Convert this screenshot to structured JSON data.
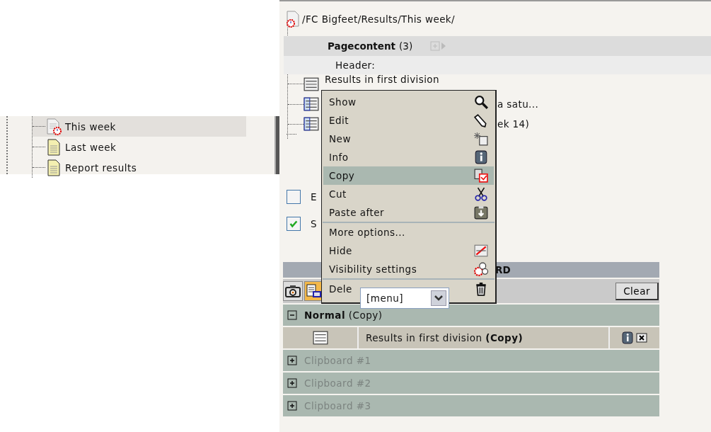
{
  "tree": {
    "items": [
      {
        "label": "This week",
        "kind": "clock-page",
        "selected": true
      },
      {
        "label": "Last week",
        "kind": "page",
        "selected": false
      },
      {
        "label": "Report results",
        "kind": "page",
        "selected": false
      }
    ]
  },
  "path": "/FC Bigfeet/Results/This week/",
  "pagecontent": {
    "title": "Pagecontent",
    "count": "(3)",
    "section": "Header:",
    "rows": [
      {
        "text": "Results in first division",
        "kind": "plain"
      },
      {
        "text": "a satu...",
        "kind": "blue"
      },
      {
        "text": "ek 14)",
        "kind": "blue"
      }
    ]
  },
  "checkboxes": [
    {
      "label": "E",
      "checked": false
    },
    {
      "label": "S",
      "checked": true
    }
  ],
  "clipboard": {
    "header": "RD",
    "select": "[menu]",
    "clear": "Clear",
    "tabs": [
      {
        "kind": "camera",
        "selected": false
      },
      {
        "kind": "doc",
        "selected": true
      }
    ],
    "groups": [
      {
        "title": "**Normal** (Copy)",
        "expanded": true,
        "items": [
          {
            "text": "Results in first division **(Copy)**"
          }
        ]
      },
      {
        "title": "Clipboard #1",
        "expanded": false
      },
      {
        "title": "Clipboard #2",
        "expanded": false
      },
      {
        "title": "Clipboard #3",
        "expanded": false
      }
    ]
  },
  "context_menu": {
    "items": [
      {
        "label": "Show",
        "kind": "search",
        "selected": false,
        "separator_after": false
      },
      {
        "label": "Edit",
        "kind": "pencil",
        "selected": false,
        "separator_after": false
      },
      {
        "label": "New",
        "kind": "new",
        "selected": false,
        "separator_after": false
      },
      {
        "label": "Info",
        "kind": "info",
        "selected": false,
        "separator_after": false
      },
      {
        "label": "Copy",
        "kind": "copy",
        "selected": true,
        "separator_after": false
      },
      {
        "label": "Cut",
        "kind": "cut",
        "selected": false,
        "separator_after": false
      },
      {
        "label": "Paste after",
        "kind": "paste",
        "selected": false,
        "separator_after": true
      },
      {
        "label": "More options...",
        "kind": "none",
        "selected": false,
        "separator_after": false
      },
      {
        "label": "Hide",
        "kind": "hide",
        "selected": false,
        "separator_after": false
      },
      {
        "label": "Visibility settings",
        "kind": "visibility",
        "selected": false,
        "separator_after": true
      },
      {
        "label": "Dele",
        "kind": "trash",
        "selected": false,
        "separator_after": false
      }
    ]
  }
}
